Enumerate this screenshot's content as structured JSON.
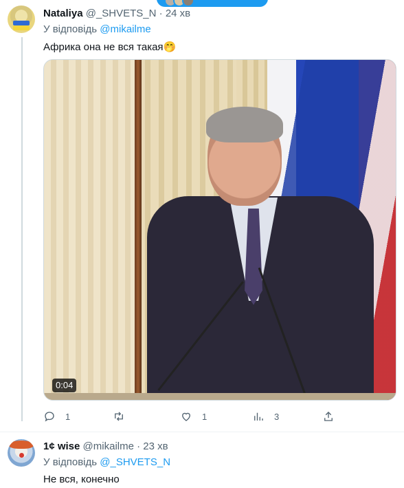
{
  "tweet1": {
    "name": "Nataliya",
    "handle": "@_SHVETS_N",
    "separator": "·",
    "time": "24 хв",
    "reply_prefix": "У відповідь",
    "reply_to": "@mikailme",
    "text": "Африка она не вся такая🤭",
    "video_duration": "0:04",
    "replies": "1",
    "likes": "1",
    "views": "3"
  },
  "tweet2": {
    "name": "1¢ wise",
    "handle": "@mikailme",
    "separator": "·",
    "time": "23 хв",
    "reply_prefix": "У відповідь",
    "reply_to": "@_SHVETS_N",
    "text": "Не вся, конечно"
  },
  "colors": {
    "accent": "#1d9bf0",
    "text_primary": "#0f1419",
    "text_secondary": "#536471",
    "border": "#cfd9de"
  },
  "icons": [
    "reply-icon",
    "retweet-icon",
    "like-icon",
    "views-icon",
    "share-icon"
  ]
}
